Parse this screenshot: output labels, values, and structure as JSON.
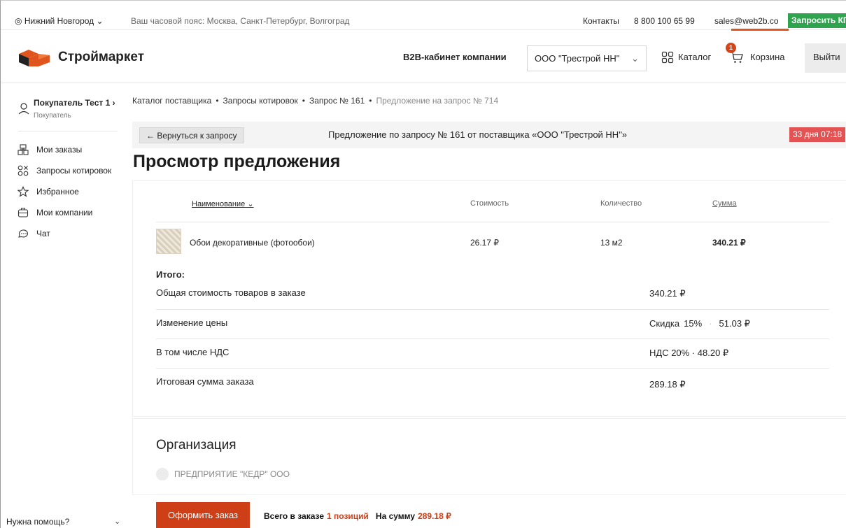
{
  "topbar": {
    "city": "Нижний Новгород",
    "timezone": "Ваш часовой пояс: Москва, Санкт-Петербург, Волгоград",
    "contacts": "Контакты",
    "phone": "8 800 100 65 99",
    "email": "sales@web2b.co",
    "request_kp": "Запросить КП"
  },
  "header": {
    "brand": "Строймаркет",
    "b2b_label": "B2B-кабинет компании",
    "company_select": "ООО \"Трестрой НН\"",
    "catalog": "Каталог",
    "cart": "Корзина",
    "cart_count": "1",
    "logout": "Выйти"
  },
  "sidebar": {
    "user_name": "Покупатель Тест 1 ›",
    "user_role": "Покупатель",
    "items": [
      {
        "label": "Мои заказы",
        "icon": "orders-icon"
      },
      {
        "label": "Запросы котировок",
        "icon": "quotes-icon"
      },
      {
        "label": "Избранное",
        "icon": "star-icon"
      },
      {
        "label": "Мои компании",
        "icon": "company-icon"
      },
      {
        "label": "Чат",
        "icon": "chat-icon"
      }
    ],
    "help": "Нужна помощь?"
  },
  "breadcrumbs": [
    "Каталог поставщика",
    "Запросы котировок",
    "Запрос № 161",
    "Предложение на запрос № 714"
  ],
  "banner": {
    "back": "← Вернуться к запросу",
    "title": "Предложение по запросу № 161 от поставщика «ООО \"Трестрой НН\"»",
    "timer": "33 дня 07:18"
  },
  "page_title": "Просмотр предложения",
  "table": {
    "headers": {
      "name": "Наименование",
      "price": "Стоимость",
      "qty": "Количество",
      "sum": "Сумма"
    },
    "rows": [
      {
        "name": "Обои декоративные (фотообои)",
        "price": "26.17 ₽",
        "qty": "13 м2",
        "sum": "340.21 ₽"
      }
    ]
  },
  "totals": {
    "title": "Итого:",
    "goods_label": "Общая стоимость товаров в заказе",
    "goods_value": "340.21 ₽",
    "change_label": "Изменение цены",
    "change_kind": "Скидка",
    "change_percent": "15%",
    "change_value": "51.03 ₽",
    "vat_label": "В том числе НДС",
    "vat_value": "НДС 20% · 48.20 ₽",
    "final_label": "Итоговая сумма заказа",
    "final_value": "289.18 ₽"
  },
  "organization": {
    "title": "Организация",
    "option": "ПРЕДПРИЯТИЕ \"КЕДР\" ООО"
  },
  "footer": {
    "order_button": "Оформить заказ",
    "total_label": "Всего в заказе",
    "positions": "1 позиций",
    "sum_label": "На сумму",
    "sum_value": "289.18 ₽"
  },
  "colors": {
    "accent": "#cf3f17",
    "green": "#2ea44f",
    "timer": "#e45353"
  }
}
